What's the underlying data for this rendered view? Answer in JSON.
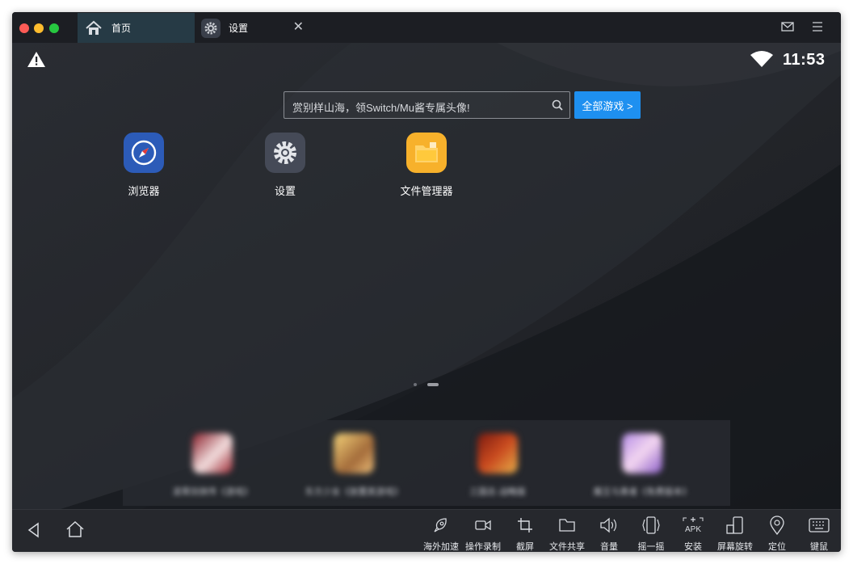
{
  "window": {
    "traffic_lights": [
      "#fd5b56",
      "#fdbc2e",
      "#27c840"
    ]
  },
  "tabs": [
    {
      "label": "首页",
      "icon": "home-icon",
      "active": true
    },
    {
      "label": "设置",
      "icon": "gear-icon",
      "active": false,
      "close": "✕"
    }
  ],
  "titlebar": {
    "right_icons": [
      "mail-icon",
      "menu-icon"
    ]
  },
  "status_bar": {
    "warning_icon": "warning-icon",
    "wifi_icon": "wifi-icon",
    "time": "11:53"
  },
  "search": {
    "placeholder": "赏别样山海，领Switch/Mu酱专属头像!",
    "button": "全部游戏 >"
  },
  "apps": [
    {
      "label": "浏览器",
      "icon": "compass-icon"
    },
    {
      "label": "设置",
      "icon": "gear-icon"
    },
    {
      "label": "文件管理器",
      "icon": "folder-icon"
    }
  ],
  "page_indicator": {
    "pages": 2,
    "current": 2
  },
  "game_strip": [
    {
      "label": "凌霄剑侠传《游戏》"
    },
    {
      "label": "东方少女《放置类游戏》"
    },
    {
      "label": "三国志·战略版"
    },
    {
      "label": "魔王与勇者《免费版本》"
    }
  ],
  "nav": {
    "back_icon": "back-icon",
    "home_icon": "home-icon"
  },
  "toolbar": [
    {
      "label": "海外加速",
      "icon": "rocket-icon"
    },
    {
      "label": "操作录制",
      "icon": "video-icon"
    },
    {
      "label": "截屏",
      "icon": "crop-icon"
    },
    {
      "label": "文件共享",
      "icon": "folder-icon"
    },
    {
      "label": "音量",
      "icon": "volume-icon"
    },
    {
      "label": "摇一摇",
      "icon": "shake-icon"
    },
    {
      "label": "安装",
      "icon": "apk-icon",
      "icon_text": "APK"
    },
    {
      "label": "屏幕旋转",
      "icon": "rotate-icon"
    },
    {
      "label": "定位",
      "icon": "location-icon"
    },
    {
      "label": "键鼠",
      "icon": "keyboard-icon"
    }
  ],
  "colors": {
    "accent": "#1e90f0",
    "active_tab": "#263a45",
    "window_bg": "#1d1f24"
  }
}
